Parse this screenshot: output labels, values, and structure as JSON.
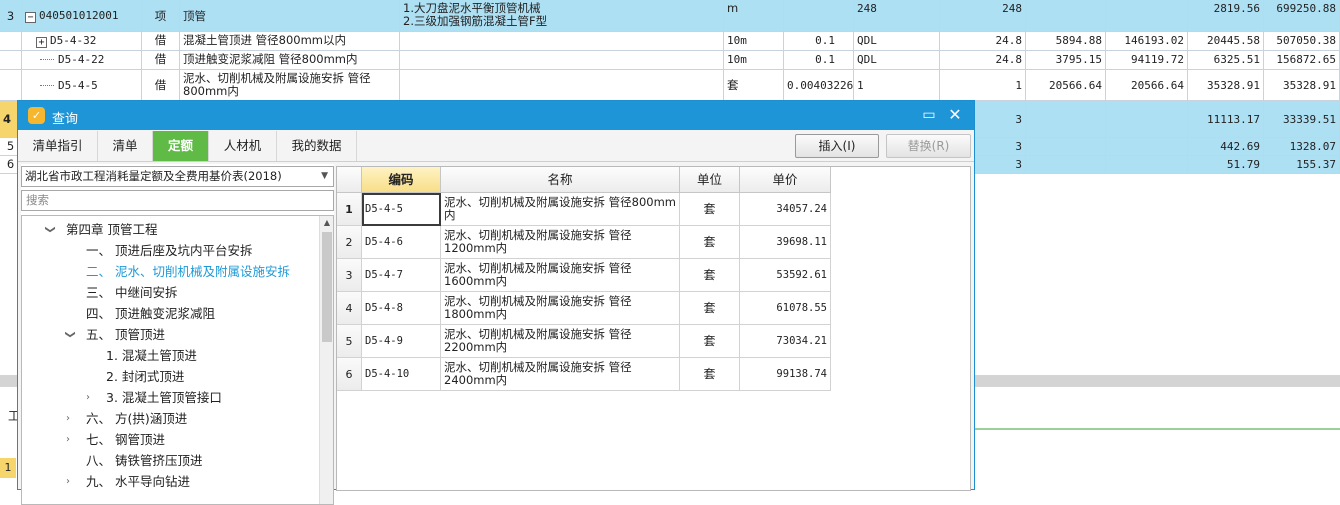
{
  "background_rows": [
    {
      "row_no": "3",
      "expander": "−",
      "code": "040501012001",
      "type": "项",
      "name": "顶管",
      "feature_lines": [
        "1.大刀盘泥水平衡顶管机械",
        "2.三级加强钢筋混凝土管F型"
      ],
      "unit": "m",
      "coef": "",
      "qty_expr": "248",
      "qty": "248",
      "c1": "",
      "c2": "",
      "c3": "2819.56",
      "c4": "699250.88"
    },
    {
      "row_no": "",
      "expander": "+",
      "code": "D5-4-32",
      "type": "借",
      "name": "混凝土管顶进 管径800mm以内",
      "feature_lines": [],
      "unit": "10m",
      "coef": "0.1",
      "qty_expr": "QDL",
      "qty": "24.8",
      "c1": "5894.88",
      "c2": "146193.02",
      "c3": "20445.58",
      "c4": "507050.38"
    },
    {
      "row_no": "",
      "expander": "",
      "code": "D5-4-22",
      "type": "借",
      "name": "顶进触变泥浆减阻 管径800mm内",
      "feature_lines": [],
      "unit": "10m",
      "coef": "0.1",
      "qty_expr": "QDL",
      "qty": "24.8",
      "c1": "3795.15",
      "c2": "94119.72",
      "c3": "6325.51",
      "c4": "156872.65"
    },
    {
      "row_no": "",
      "expander": "",
      "code": "D5-4-5",
      "type": "借",
      "name": "泥水、切削机械及附属设施安拆 管径800mm内",
      "feature_lines": [],
      "unit": "套",
      "coef": "0.00403226",
      "qty_expr": "1",
      "qty": "1",
      "c1": "20566.64",
      "c2": "20566.64",
      "c3": "35328.91",
      "c4": "35328.91"
    },
    {
      "row_no": "4",
      "qty": "3",
      "c3": "11113.17",
      "c4": "33339.51"
    },
    {
      "row_no": "5",
      "qty": "3",
      "c3": "442.69",
      "c4": "1328.07"
    },
    {
      "row_no": "6",
      "qty": "3",
      "c3": "51.79",
      "c4": "155.37"
    }
  ],
  "background_misc": {
    "left_edge_1": "1",
    "left_edge_2": "工"
  },
  "dialog": {
    "title": "查询",
    "icon_glyph": "✓",
    "tabs": [
      "清单指引",
      "清单",
      "定额",
      "人材机",
      "我的数据"
    ],
    "active_tab": "定额",
    "insert_label": "插入(I)",
    "replace_label": "替换(R)",
    "library_select": "湖北省市政工程消耗量定额及全费用基价表(2018)",
    "search_placeholder": "搜索",
    "tree": [
      {
        "label": "第四章  顶管工程",
        "level": 0,
        "caret": "down"
      },
      {
        "label": "一、  顶进后座及坑内平台安拆",
        "level": 1,
        "caret": ""
      },
      {
        "label": "二、  泥水、切削机械及附属设施安拆",
        "level": 1,
        "caret": "",
        "highlight": true
      },
      {
        "label": "三、  中继间安拆",
        "level": 1,
        "caret": ""
      },
      {
        "label": "四、  顶进触变泥浆减阻",
        "level": 1,
        "caret": ""
      },
      {
        "label": "五、  顶管顶进",
        "level": 1,
        "caret": "down"
      },
      {
        "label": "1. 混凝土管顶进",
        "level": 2,
        "caret": ""
      },
      {
        "label": "2. 封闭式顶进",
        "level": 2,
        "caret": ""
      },
      {
        "label": "3. 混凝土管顶管接口",
        "level": 2,
        "caret": "right"
      },
      {
        "label": "六、  方(拱)涵顶进",
        "level": 1,
        "caret": "right"
      },
      {
        "label": "七、  钢管顶进",
        "level": 1,
        "caret": "right"
      },
      {
        "label": "八、  铸铁管挤压顶进",
        "level": 1,
        "caret": ""
      },
      {
        "label": "九、  水平导向钻进",
        "level": 1,
        "caret": "right"
      }
    ],
    "grid": {
      "headers": [
        "",
        "编码",
        "名称",
        "单位",
        "单价"
      ],
      "rows": [
        {
          "idx": "1",
          "code": "D5-4-5",
          "name": "泥水、切削机械及附属设施安拆 管径800mm内",
          "unit": "套",
          "price": "34057.24"
        },
        {
          "idx": "2",
          "code": "D5-4-6",
          "name": "泥水、切削机械及附属设施安拆 管径1200mm内",
          "unit": "套",
          "price": "39698.11"
        },
        {
          "idx": "3",
          "code": "D5-4-7",
          "name": "泥水、切削机械及附属设施安拆 管径1600mm内",
          "unit": "套",
          "price": "53592.61"
        },
        {
          "idx": "4",
          "code": "D5-4-8",
          "name": "泥水、切削机械及附属设施安拆 管径1800mm内",
          "unit": "套",
          "price": "61078.55"
        },
        {
          "idx": "5",
          "code": "D5-4-9",
          "name": "泥水、切削机械及附属设施安拆 管径2200mm内",
          "unit": "套",
          "price": "73034.21"
        },
        {
          "idx": "6",
          "code": "D5-4-10",
          "name": "泥水、切削机械及附属设施安拆 管径2400mm内",
          "unit": "套",
          "price": "99138.74"
        }
      ]
    }
  }
}
